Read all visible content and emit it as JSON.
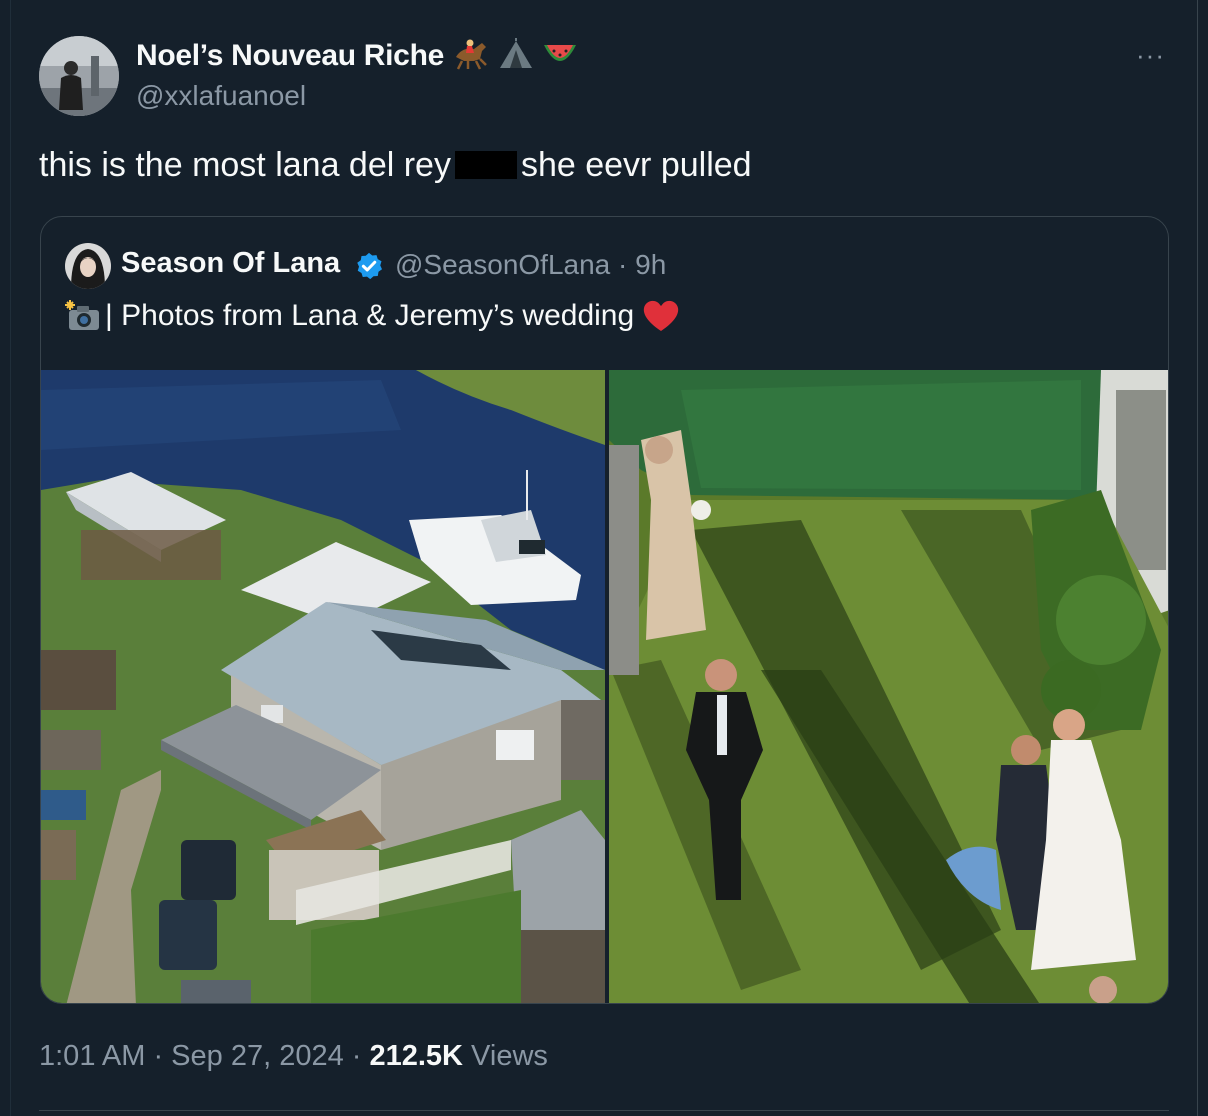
{
  "tweet": {
    "author_name": "Noel’s Nouveau Riche",
    "author_emojis": [
      "horse-racing-emoji",
      "tent-emoji",
      "watermelon-emoji"
    ],
    "author_handle": "@xxlafuanoel",
    "more_label": "···",
    "text_before": "this is the most lana del rey",
    "text_after": "she eevr pulled",
    "timestamp": "1:01 AM · Sep 27, 2024 · ",
    "views_count": "212.5K",
    "views_label": " Views"
  },
  "quoted": {
    "author_name": "Season Of Lana",
    "author_handle": "@SeasonOfLana · 9h",
    "verified": true,
    "text": "| Photos from Lana & Jeremy’s wedding",
    "leading_icon": "camera-flash-emoji",
    "trailing_icon": "red-heart-emoji"
  },
  "colors": {
    "background": "#15202b",
    "primary_text": "#f7f9f9",
    "secondary_text": "#8b98a5",
    "border": "#38444d",
    "verified": "#1d9bf0"
  }
}
